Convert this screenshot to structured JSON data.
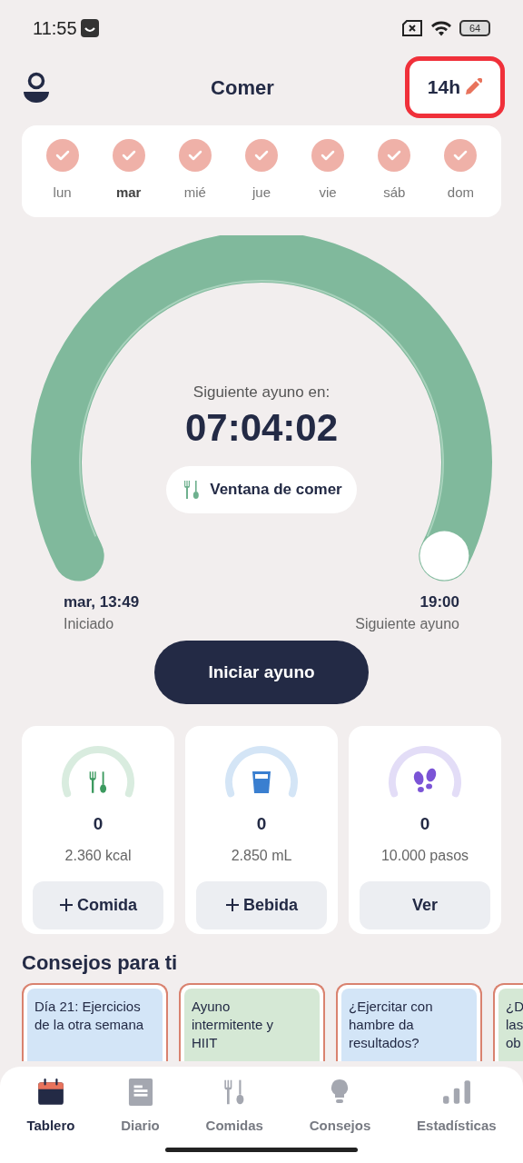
{
  "status_bar": {
    "time": "11:55",
    "battery": "64"
  },
  "header": {
    "title": "Comer",
    "goal": "14h",
    "goal_highlighted": true
  },
  "days": [
    {
      "label": "lun",
      "checked": true,
      "selected": false
    },
    {
      "label": "mar",
      "checked": true,
      "selected": true
    },
    {
      "label": "mié",
      "checked": true,
      "selected": false
    },
    {
      "label": "jue",
      "checked": true,
      "selected": false
    },
    {
      "label": "vie",
      "checked": true,
      "selected": false
    },
    {
      "label": "sáb",
      "checked": true,
      "selected": false
    },
    {
      "label": "dom",
      "checked": true,
      "selected": false
    }
  ],
  "timer": {
    "caption": "Siguiente ayuno en:",
    "time": "07:04:02",
    "phase": "Ventana de comer",
    "start": {
      "value": "mar, 13:49",
      "label": "Iniciado"
    },
    "end": {
      "value": "19:00",
      "label": "Siguiente ayuno"
    }
  },
  "primary_button": "Iniciar ayuno",
  "stats": [
    {
      "kind": "food",
      "value": "0",
      "target": "2.360 kcal",
      "button": "Comida",
      "plus": true
    },
    {
      "kind": "drink",
      "value": "0",
      "target": "2.850 mL",
      "button": "Bebida",
      "plus": true
    },
    {
      "kind": "steps",
      "value": "0",
      "target": "10.000 pasos",
      "button": "Ver",
      "plus": false
    }
  ],
  "tips": {
    "title": "Consejos para ti",
    "items": [
      {
        "lines": [
          "Día 21: Ejercicios",
          "de la otra semana"
        ],
        "color": "#d3e5f7"
      },
      {
        "lines": [
          "Ayuno",
          "intermitente y",
          "HIIT"
        ],
        "color": "#d5e8d5"
      },
      {
        "lines": [
          "¿Ejercitar con",
          "hambre da",
          "resultados?"
        ],
        "color": "#d3e5f7"
      },
      {
        "lines": [
          "¿D",
          "las",
          "ob"
        ],
        "color": "#d5e8d5"
      }
    ]
  },
  "nav": [
    {
      "kind": "calendar",
      "label": "Tablero",
      "selected": true
    },
    {
      "kind": "diary",
      "label": "Diario",
      "selected": false
    },
    {
      "kind": "meals",
      "label": "Comidas",
      "selected": false
    },
    {
      "kind": "tips",
      "label": "Consejos",
      "selected": false
    },
    {
      "kind": "stats",
      "label": "Estadísticas",
      "selected": false
    }
  ]
}
